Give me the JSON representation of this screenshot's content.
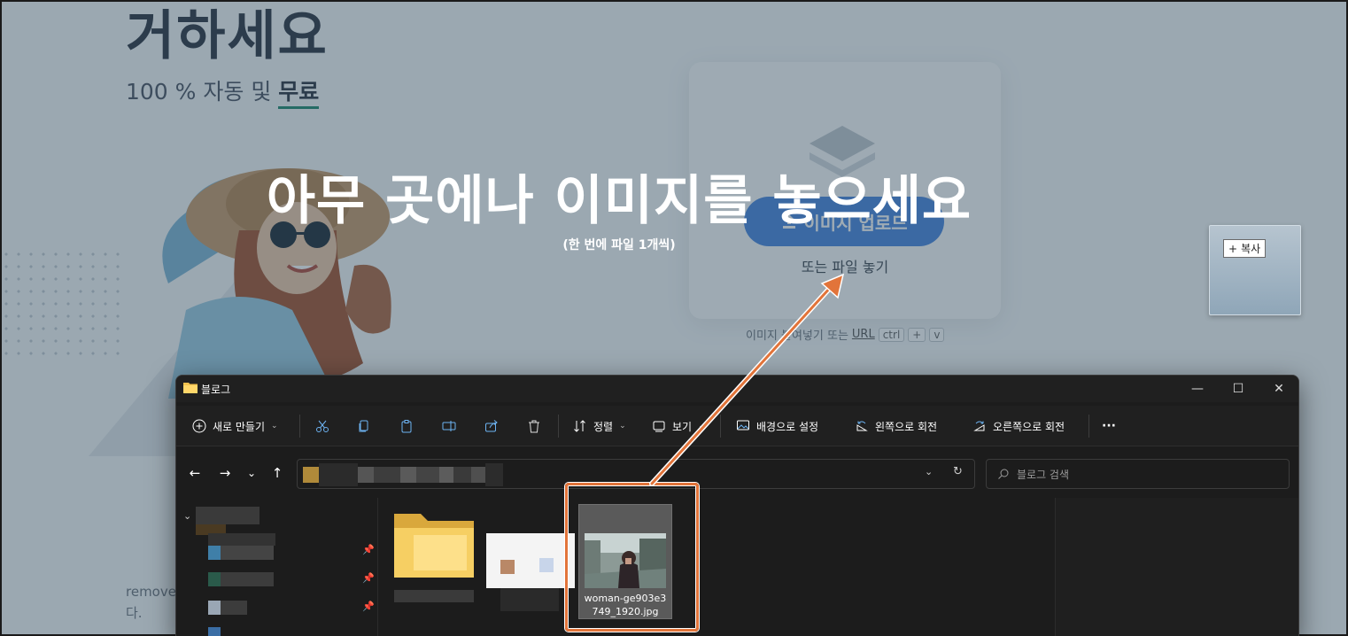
{
  "webpage": {
    "hero_title": "거하세요",
    "hero_subtitle_prefix": "100 % 자동 및 ",
    "hero_subtitle_highlight": "무료",
    "upload_button": "이미지 업로드",
    "drop_file_text": "또는 파일 놓기",
    "paste_hint_prefix": "이미지 붙여넣기 또는",
    "paste_hint_url": "URL",
    "shortcut_keys": [
      "ctrl",
      "+",
      "v"
    ],
    "remove_text_line1": "remove",
    "remove_text_line2": "다."
  },
  "drop_overlay": {
    "title": "아무 곳에나 이미지를 놓으세요",
    "subtitle": "(한 번에 파일 1개씩)"
  },
  "drag_ghost": {
    "badge_symbol": "+",
    "badge_label": "복사"
  },
  "explorer": {
    "window_title": "블로그",
    "window_controls": {
      "minimize": "—",
      "maximize": "☐",
      "close": "✕"
    },
    "toolbar": {
      "new_label": "새로 만들기",
      "sort_label": "정렬",
      "view_label": "보기",
      "set_background_label": "배경으로 설정",
      "rotate_left_label": "왼쪽으로 회전",
      "rotate_right_label": "오른쪽으로 회전",
      "more_label": "···"
    },
    "nav": {
      "back": "←",
      "forward": "→",
      "recent": "⌄",
      "up": "↑"
    },
    "search_placeholder": "블로그 검색",
    "selected_file": {
      "name_line1": "woman-ge903e3",
      "name_line2": "749_1920.jpg"
    }
  },
  "colors": {
    "overlay": "#2e485c",
    "upload_button": "#4686e0",
    "highlight": "#e2743a",
    "explorer_bg": "#1c1c1c"
  }
}
